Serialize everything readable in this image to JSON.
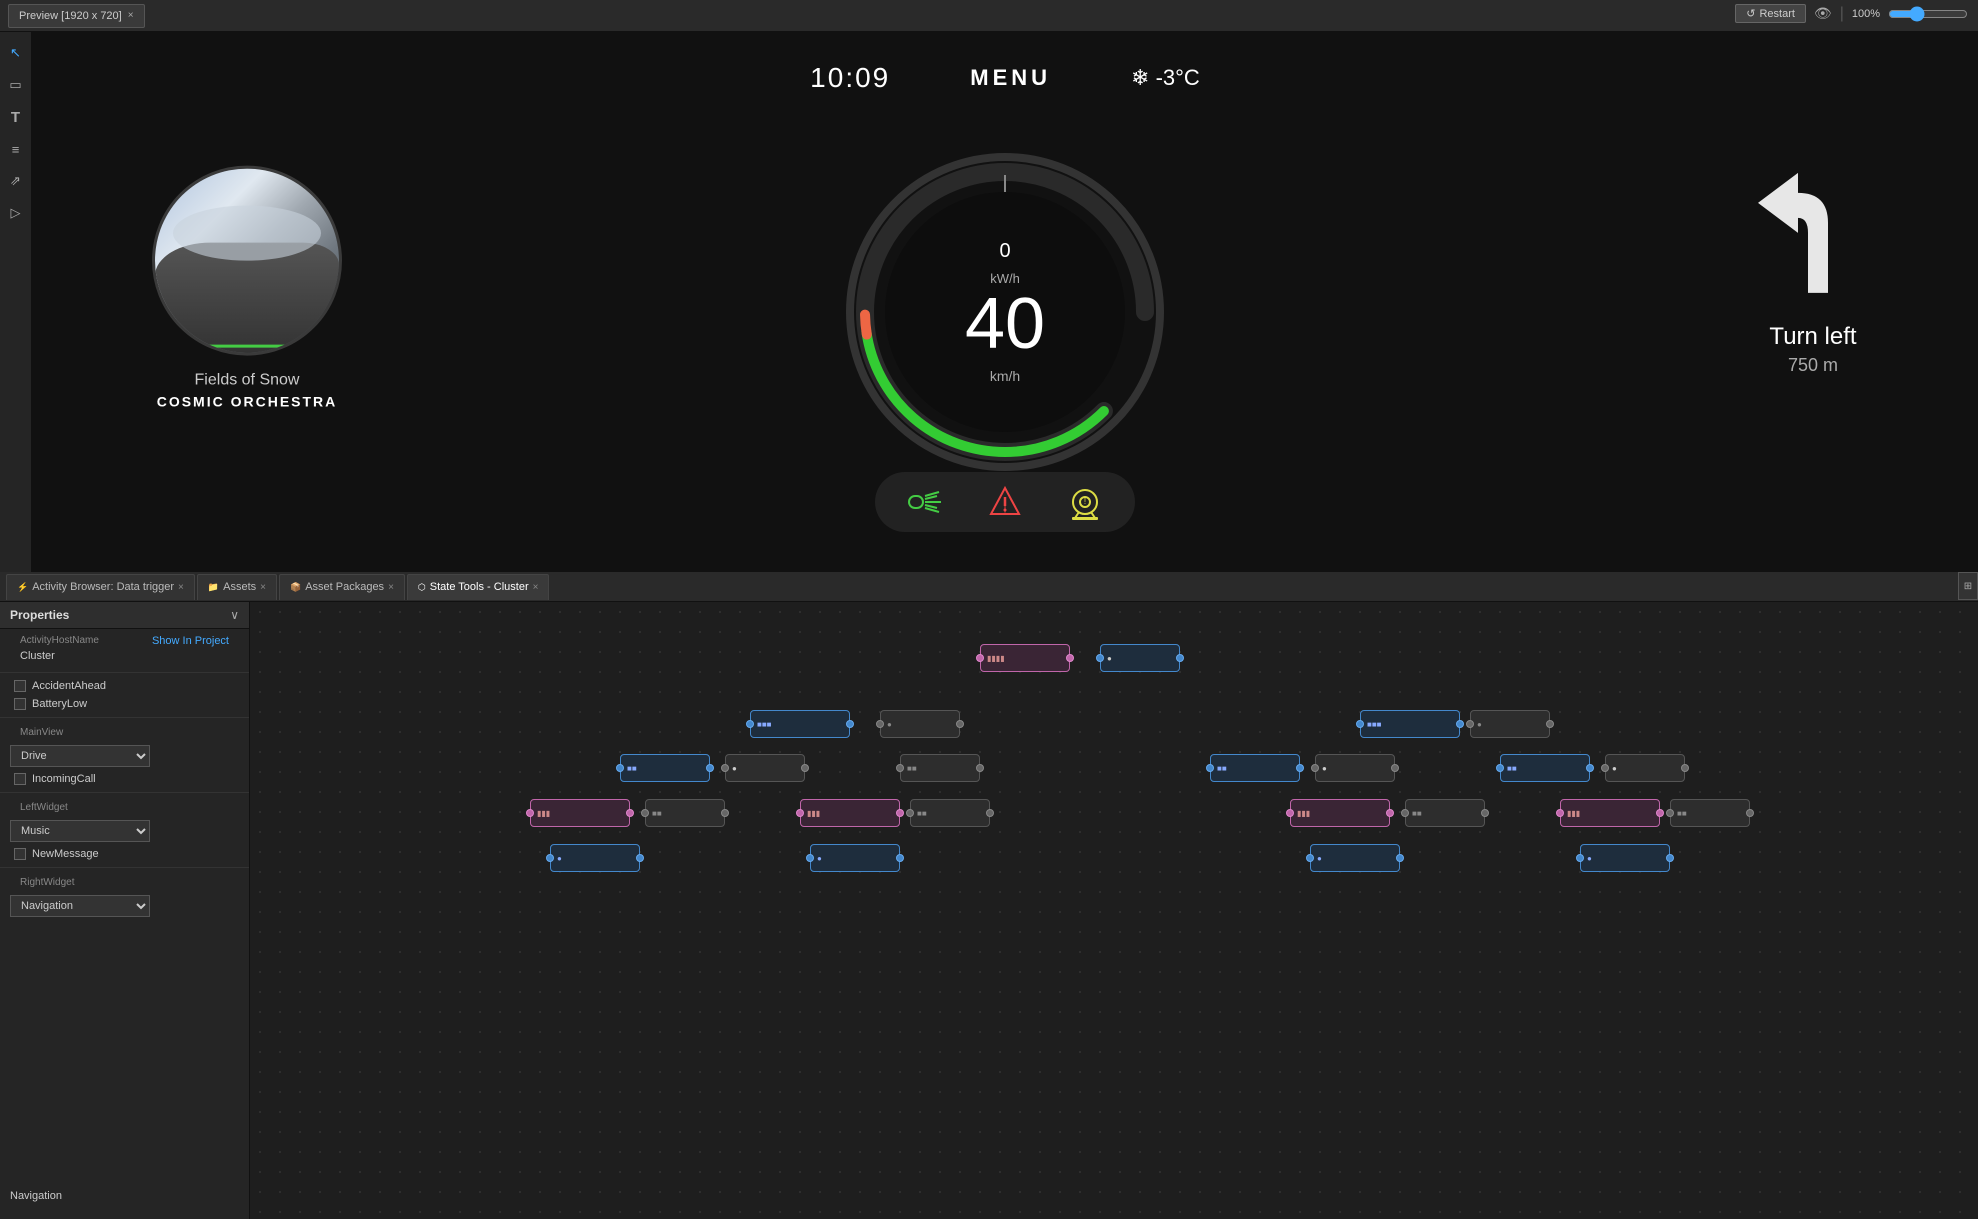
{
  "window": {
    "title": "Preview [1920 x 720]",
    "zoom": "100%"
  },
  "toolbar": {
    "restart_label": "Restart",
    "zoom_label": "100%"
  },
  "tabs": [
    {
      "label": "Activity Browser: Data trigger",
      "closable": true
    },
    {
      "label": "Assets",
      "closable": true
    },
    {
      "label": "Asset Packages",
      "closable": true
    },
    {
      "label": "State Tools - Cluster",
      "closable": true
    }
  ],
  "cluster": {
    "time": "10:09",
    "menu": "MENU",
    "weather": "❄ -3°C",
    "speed": "40",
    "speed_unit": "km/h",
    "power": "0",
    "power_unit": "kW/h",
    "album_title": "Fields of Snow",
    "album_artist": "COSMIC ORCHESTRA",
    "nav_label": "Turn left",
    "nav_distance": "750 m"
  },
  "properties": {
    "title": "Properties",
    "activity_host_name_label": "ActivityHostName",
    "activity_host_name_value": "Cluster",
    "show_in_project_label": "Show In Project",
    "accident_ahead_label": "AccidentAhead",
    "battery_low_label": "BatteryLow",
    "main_view_label": "MainView",
    "main_view_value": "Drive",
    "incoming_call_label": "IncomingCall",
    "left_widget_label": "LeftWidget",
    "left_widget_value": "Music",
    "new_message_label": "NewMessage",
    "right_widget_label": "RightWidget",
    "navigation_label": "Navigation"
  },
  "sidebar_icons": [
    {
      "name": "pointer-icon",
      "symbol": "↖"
    },
    {
      "name": "rect-icon",
      "symbol": "▭"
    },
    {
      "name": "text-icon",
      "symbol": "T"
    },
    {
      "name": "layers-icon",
      "symbol": "≡"
    },
    {
      "name": "share-icon",
      "symbol": "⇱"
    },
    {
      "name": "video-icon",
      "symbol": "▶"
    }
  ]
}
